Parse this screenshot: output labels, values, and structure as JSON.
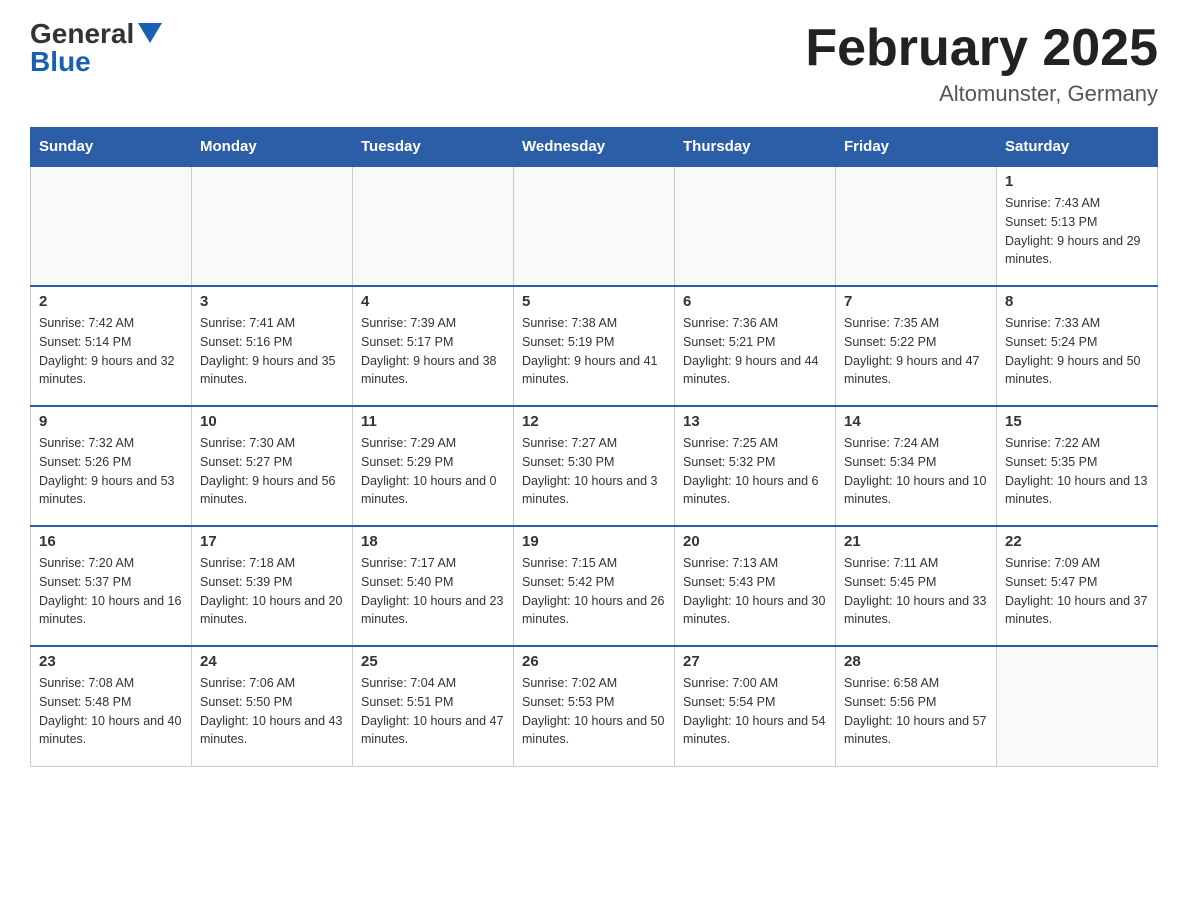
{
  "header": {
    "logo": {
      "general": "General",
      "blue": "Blue"
    },
    "title": "February 2025",
    "subtitle": "Altomunster, Germany"
  },
  "weekdays": [
    "Sunday",
    "Monday",
    "Tuesday",
    "Wednesday",
    "Thursday",
    "Friday",
    "Saturday"
  ],
  "weeks": [
    [
      {
        "day": "",
        "info": ""
      },
      {
        "day": "",
        "info": ""
      },
      {
        "day": "",
        "info": ""
      },
      {
        "day": "",
        "info": ""
      },
      {
        "day": "",
        "info": ""
      },
      {
        "day": "",
        "info": ""
      },
      {
        "day": "1",
        "info": "Sunrise: 7:43 AM\nSunset: 5:13 PM\nDaylight: 9 hours and 29 minutes."
      }
    ],
    [
      {
        "day": "2",
        "info": "Sunrise: 7:42 AM\nSunset: 5:14 PM\nDaylight: 9 hours and 32 minutes."
      },
      {
        "day": "3",
        "info": "Sunrise: 7:41 AM\nSunset: 5:16 PM\nDaylight: 9 hours and 35 minutes."
      },
      {
        "day": "4",
        "info": "Sunrise: 7:39 AM\nSunset: 5:17 PM\nDaylight: 9 hours and 38 minutes."
      },
      {
        "day": "5",
        "info": "Sunrise: 7:38 AM\nSunset: 5:19 PM\nDaylight: 9 hours and 41 minutes."
      },
      {
        "day": "6",
        "info": "Sunrise: 7:36 AM\nSunset: 5:21 PM\nDaylight: 9 hours and 44 minutes."
      },
      {
        "day": "7",
        "info": "Sunrise: 7:35 AM\nSunset: 5:22 PM\nDaylight: 9 hours and 47 minutes."
      },
      {
        "day": "8",
        "info": "Sunrise: 7:33 AM\nSunset: 5:24 PM\nDaylight: 9 hours and 50 minutes."
      }
    ],
    [
      {
        "day": "9",
        "info": "Sunrise: 7:32 AM\nSunset: 5:26 PM\nDaylight: 9 hours and 53 minutes."
      },
      {
        "day": "10",
        "info": "Sunrise: 7:30 AM\nSunset: 5:27 PM\nDaylight: 9 hours and 56 minutes."
      },
      {
        "day": "11",
        "info": "Sunrise: 7:29 AM\nSunset: 5:29 PM\nDaylight: 10 hours and 0 minutes."
      },
      {
        "day": "12",
        "info": "Sunrise: 7:27 AM\nSunset: 5:30 PM\nDaylight: 10 hours and 3 minutes."
      },
      {
        "day": "13",
        "info": "Sunrise: 7:25 AM\nSunset: 5:32 PM\nDaylight: 10 hours and 6 minutes."
      },
      {
        "day": "14",
        "info": "Sunrise: 7:24 AM\nSunset: 5:34 PM\nDaylight: 10 hours and 10 minutes."
      },
      {
        "day": "15",
        "info": "Sunrise: 7:22 AM\nSunset: 5:35 PM\nDaylight: 10 hours and 13 minutes."
      }
    ],
    [
      {
        "day": "16",
        "info": "Sunrise: 7:20 AM\nSunset: 5:37 PM\nDaylight: 10 hours and 16 minutes."
      },
      {
        "day": "17",
        "info": "Sunrise: 7:18 AM\nSunset: 5:39 PM\nDaylight: 10 hours and 20 minutes."
      },
      {
        "day": "18",
        "info": "Sunrise: 7:17 AM\nSunset: 5:40 PM\nDaylight: 10 hours and 23 minutes."
      },
      {
        "day": "19",
        "info": "Sunrise: 7:15 AM\nSunset: 5:42 PM\nDaylight: 10 hours and 26 minutes."
      },
      {
        "day": "20",
        "info": "Sunrise: 7:13 AM\nSunset: 5:43 PM\nDaylight: 10 hours and 30 minutes."
      },
      {
        "day": "21",
        "info": "Sunrise: 7:11 AM\nSunset: 5:45 PM\nDaylight: 10 hours and 33 minutes."
      },
      {
        "day": "22",
        "info": "Sunrise: 7:09 AM\nSunset: 5:47 PM\nDaylight: 10 hours and 37 minutes."
      }
    ],
    [
      {
        "day": "23",
        "info": "Sunrise: 7:08 AM\nSunset: 5:48 PM\nDaylight: 10 hours and 40 minutes."
      },
      {
        "day": "24",
        "info": "Sunrise: 7:06 AM\nSunset: 5:50 PM\nDaylight: 10 hours and 43 minutes."
      },
      {
        "day": "25",
        "info": "Sunrise: 7:04 AM\nSunset: 5:51 PM\nDaylight: 10 hours and 47 minutes."
      },
      {
        "day": "26",
        "info": "Sunrise: 7:02 AM\nSunset: 5:53 PM\nDaylight: 10 hours and 50 minutes."
      },
      {
        "day": "27",
        "info": "Sunrise: 7:00 AM\nSunset: 5:54 PM\nDaylight: 10 hours and 54 minutes."
      },
      {
        "day": "28",
        "info": "Sunrise: 6:58 AM\nSunset: 5:56 PM\nDaylight: 10 hours and 57 minutes."
      },
      {
        "day": "",
        "info": ""
      }
    ]
  ]
}
